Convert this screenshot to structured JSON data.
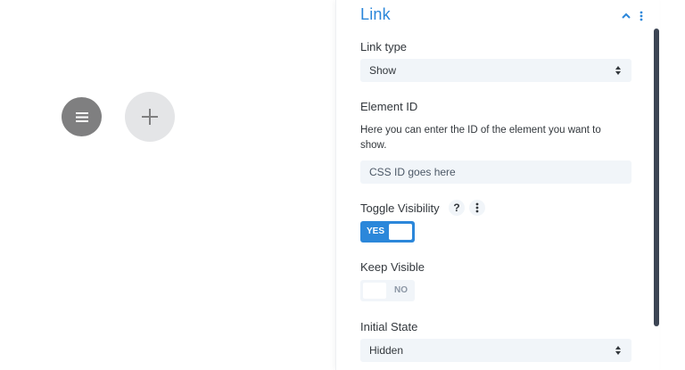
{
  "canvas": {
    "menu_icon": "hamburger-icon",
    "add_icon": "plus-icon"
  },
  "panel": {
    "title": "Link",
    "collapse_icon": "chevron-up-icon",
    "options_icon": "vertical-dots-icon",
    "accent_color": "#2b87da",
    "link_type": {
      "label": "Link type",
      "value": "Show"
    },
    "element_id": {
      "label": "Element ID",
      "description": "Here you can enter the ID of the element you want to show.",
      "placeholder": "CSS ID goes here",
      "value": ""
    },
    "toggle_visibility": {
      "label": "Toggle Visibility",
      "help_icon": "?",
      "state": "YES"
    },
    "keep_visible": {
      "label": "Keep Visible",
      "state": "NO"
    },
    "initial_state": {
      "label": "Initial State",
      "value": "Hidden"
    }
  }
}
